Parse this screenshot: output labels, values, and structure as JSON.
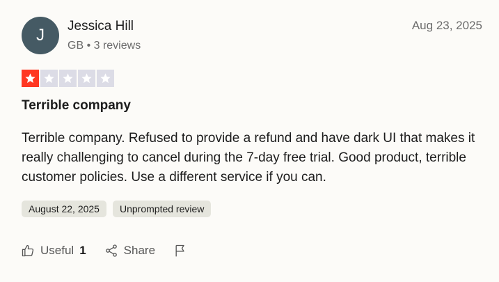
{
  "reviewer": {
    "initial": "J",
    "name": "Jessica Hill",
    "meta": "GB • 3 reviews"
  },
  "review": {
    "date": "Aug 23, 2025",
    "rating": 1,
    "rating_max": 5,
    "title": "Terrible company",
    "body": "Terrible company. Refused to provide a refund and have dark UI that makes it really challenging to cancel during the 7-day free trial. Good product, terrible customer policies. Use a different service if you can.",
    "experience_date": "August 22, 2025",
    "source_tag": "Unprompted review"
  },
  "actions": {
    "useful_label": "Useful",
    "useful_count": "1",
    "share_label": "Share"
  },
  "colors": {
    "avatar_bg": "#455a64",
    "star_filled": "#ff3722",
    "star_empty": "#dcdce6",
    "tag_bg": "#e5e5dd"
  },
  "icons": [
    "thumbs-up-icon",
    "share-icon",
    "flag-icon",
    "star-icon"
  ]
}
